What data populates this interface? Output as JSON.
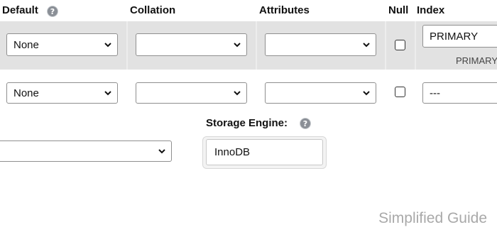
{
  "header": {
    "default_label": "Default",
    "collation_label": "Collation",
    "attributes_label": "Attributes",
    "null_label": "Null",
    "index_label": "Index"
  },
  "rows": [
    {
      "default_value": "None",
      "collation_value": "",
      "attributes_value": "",
      "null_checked": false,
      "index_value": "PRIMARY",
      "index_caption": "PRIMARY"
    },
    {
      "default_value": "None",
      "collation_value": "",
      "attributes_value": "",
      "null_checked": false,
      "index_value": "---"
    }
  ],
  "table_options": {
    "left_select_value": "",
    "storage_engine_label": "Storage Engine:",
    "storage_engine_value": "InnoDB"
  },
  "watermark": "Simplified Guide",
  "icons": {
    "help": "help-icon",
    "dropdown": "chevron-down-icon"
  },
  "colors": {
    "row_highlight": "#e2e2e2",
    "help_icon": "#8a8f96",
    "watermark": "#a9a9a9"
  }
}
